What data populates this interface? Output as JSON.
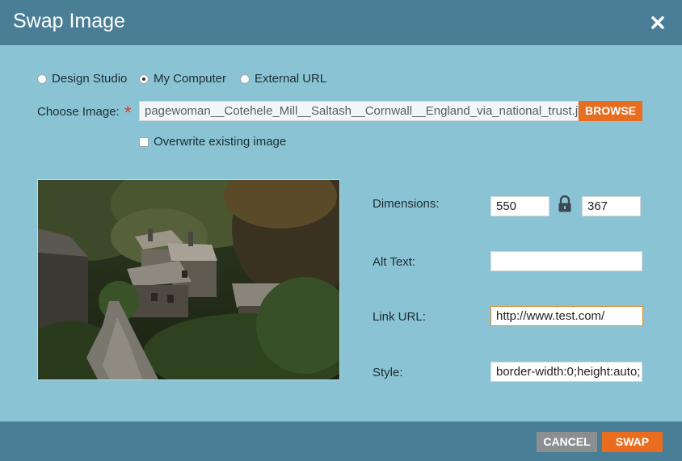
{
  "dialog": {
    "title": "Swap Image"
  },
  "source": {
    "options": [
      {
        "label": "Design Studio",
        "checked": false
      },
      {
        "label": "My Computer",
        "checked": true
      },
      {
        "label": "External URL",
        "checked": false
      }
    ]
  },
  "choose_image": {
    "label": "Choose Image:",
    "required_mark": "*",
    "filename": "pagewoman__Cotehele_Mill__Saltash__Cornwall__England_via_national_trust.jpg",
    "browse_label": "BROWSE"
  },
  "overwrite": {
    "label": "Overwrite existing image",
    "checked": false
  },
  "properties": {
    "dimensions_label": "Dimensions:",
    "width": "550",
    "height": "367",
    "alt_label": "Alt Text:",
    "alt_value": "",
    "link_label": "Link URL:",
    "link_value": "http://www.test.com/",
    "style_label": "Style:",
    "style_value": "border-width:0;height:auto;"
  },
  "footer": {
    "cancel_label": "CANCEL",
    "swap_label": "SWAP"
  },
  "colors": {
    "header": "#4a7e96",
    "body": "#8ac4d4",
    "accent": "#e86d1f",
    "cancel": "#8c8f91"
  },
  "icons": {
    "close": "close-icon",
    "lock": "lock-icon"
  }
}
